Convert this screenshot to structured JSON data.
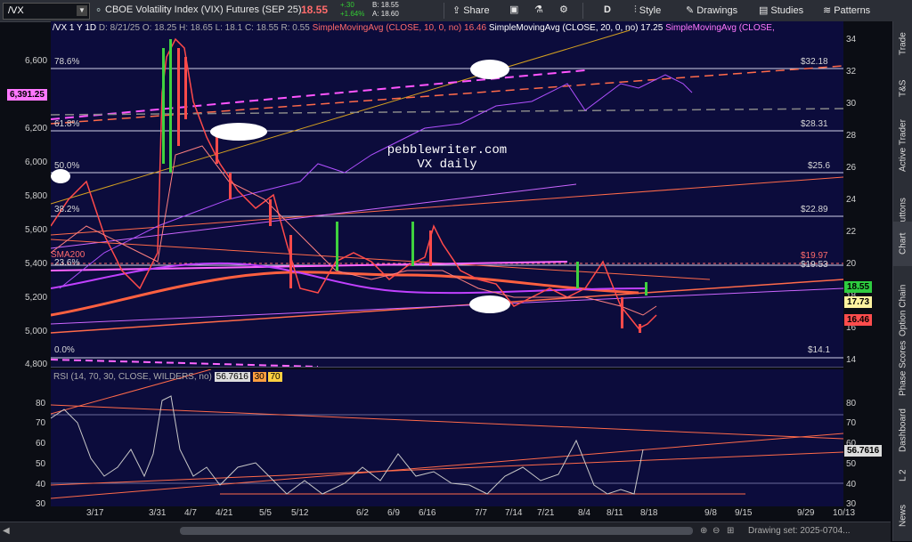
{
  "toolbar": {
    "symbol": "/VX",
    "title": "CBOE Volatility Index (VIX) Futures (SEP 25)",
    "last_price": "18.55",
    "change": "+.30",
    "change_pct": "+1.64%",
    "bid": "B: 18.55",
    "ask": "A: 18.60",
    "share_label": "Share",
    "period_label": "D",
    "style_label": "Style",
    "drawings_label": "Drawings",
    "studies_label": "Studies",
    "patterns_label": "Patterns"
  },
  "info_line": {
    "prefix": "/VX 1 Y 1D",
    "date": "D: 8/21/25",
    "open": "O: 18.25",
    "high": "H: 18.65",
    "low": "L: 18.1",
    "close": "C: 18.55",
    "range": "R: 0.55",
    "sma10": "SimpleMovingAvg (CLOSE, 10, 0, no)",
    "sma10_val": "16.46",
    "sma20": "SimpleMovingAvg (CLOSE, 20, 0, no)",
    "sma20_val": "17.25",
    "sma_other": "SimpleMovingAvg (CLOSE,"
  },
  "annotation": {
    "line1": "pebblewriter.com",
    "line2": "VX daily"
  },
  "left_axis": [
    "6,600",
    "6,391.25",
    "6,200",
    "6,000",
    "5,800",
    "5,600",
    "5,400",
    "5,200",
    "5,000",
    "4,800"
  ],
  "right_axis": [
    "34",
    "32",
    "30",
    "28",
    "26",
    "24",
    "22",
    "20",
    "18",
    "16",
    "14"
  ],
  "fib_labels": [
    "78.6%",
    "61.8%",
    "50.0%",
    "38.2%",
    "23.6%",
    "0.0%"
  ],
  "fib_values": [
    "$32.18",
    "$28.31",
    "$25.6",
    "$22.89",
    "$19.97",
    "$19.53",
    "$14.1"
  ],
  "sma200_label": "SMA200",
  "price_tags": [
    {
      "text": "18.55",
      "color": "#2ecc40"
    },
    {
      "text": "17.73",
      "color": "#fff3a0"
    },
    {
      "text": "16.46",
      "color": "#ff4d4d"
    }
  ],
  "rsi": {
    "label": "RSI (14, 70, 30, CLOSE, WILDERS, no)",
    "value": "56.7616",
    "os": "30",
    "ob": "70",
    "axis": [
      "80",
      "70",
      "60",
      "50",
      "40",
      "30"
    ],
    "right_value": "56.7616"
  },
  "x_axis": [
    "3/17",
    "3/31",
    "4/7",
    "4/21",
    "5/5",
    "5/12",
    "6/2",
    "6/9",
    "6/16",
    "7/7",
    "7/14",
    "7/21",
    "8/4",
    "8/11",
    "8/18",
    "9/8",
    "9/15",
    "9/29",
    "10/13"
  ],
  "right_rail": [
    "Trade",
    "T&S",
    "Active Trader",
    "Buttons",
    "Chart",
    "Option Chain",
    "Phase Scores",
    "Dashboard",
    "L 2",
    "News"
  ],
  "drawing_set": "Drawing set: 2025-0704..."
}
